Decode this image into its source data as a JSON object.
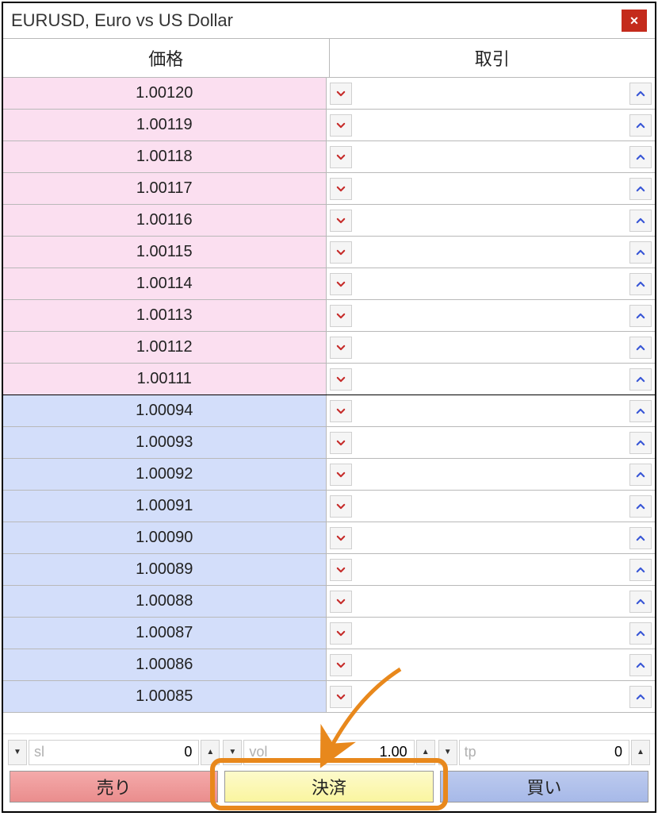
{
  "title": "EURUSD, Euro vs US Dollar",
  "headers": {
    "price": "価格",
    "trade": "取引"
  },
  "ask_rows": [
    {
      "price": "1.00120"
    },
    {
      "price": "1.00119"
    },
    {
      "price": "1.00118"
    },
    {
      "price": "1.00117"
    },
    {
      "price": "1.00116"
    },
    {
      "price": "1.00115"
    },
    {
      "price": "1.00114"
    },
    {
      "price": "1.00113"
    },
    {
      "price": "1.00112"
    },
    {
      "price": "1.00111"
    }
  ],
  "bid_rows": [
    {
      "price": "1.00094"
    },
    {
      "price": "1.00093"
    },
    {
      "price": "1.00092"
    },
    {
      "price": "1.00091"
    },
    {
      "price": "1.00090"
    },
    {
      "price": "1.00089"
    },
    {
      "price": "1.00088"
    },
    {
      "price": "1.00087"
    },
    {
      "price": "1.00086"
    },
    {
      "price": "1.00085"
    }
  ],
  "inputs": {
    "sl": {
      "label": "sl",
      "value": "0"
    },
    "vol": {
      "label": "vol",
      "value": "1.00"
    },
    "tp": {
      "label": "tp",
      "value": "0"
    }
  },
  "actions": {
    "sell": "売り",
    "settle": "決済",
    "buy": "買い"
  },
  "close_glyph": "✕"
}
